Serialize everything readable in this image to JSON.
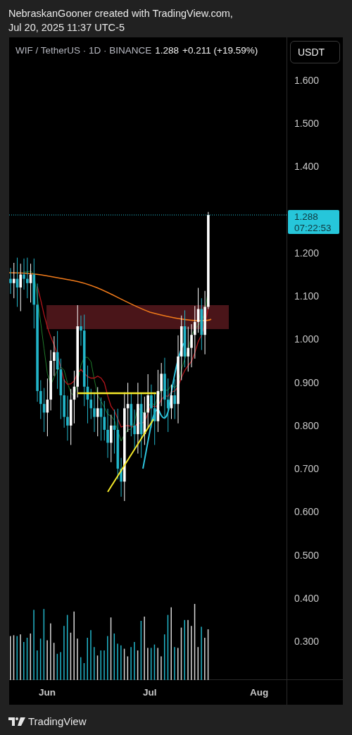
{
  "header": {
    "lines": [
      "NebraskanGooner created with TradingView.com,",
      "Jul 20, 2025 11:37 UTC-5"
    ]
  },
  "legend": {
    "symbol": "WIF / TetherUS · 1D · BINANCE",
    "price": "1.288",
    "change": "+0.211 (+19.59%)"
  },
  "currency_button": "USDT",
  "price_axis": {
    "ticks": [
      "1.600",
      "1.500",
      "1.400",
      "1.200",
      "1.100",
      "1.000",
      "0.900",
      "0.800",
      "0.700",
      "0.600",
      "0.500",
      "0.400",
      "0.300"
    ]
  },
  "last_price_label": {
    "price": "1.288",
    "countdown": "07:22:53"
  },
  "time_axis": {
    "labels": [
      "Jun",
      "Jul",
      "Aug"
    ]
  },
  "footer": {
    "brand": "TradingView"
  }
}
